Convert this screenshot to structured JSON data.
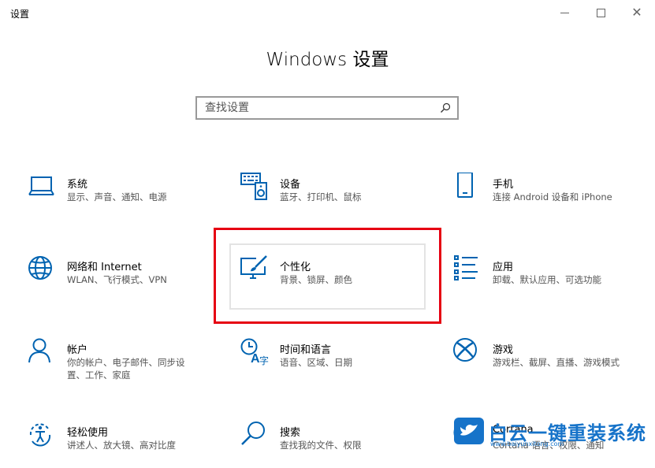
{
  "window": {
    "title": "设置",
    "heading": "Windows 设置"
  },
  "search": {
    "placeholder": "查找设置"
  },
  "accent_color": "#0063b1",
  "highlight_color": "#e60012",
  "tiles": [
    {
      "name": "系统",
      "desc": "显示、声音、通知、电源",
      "icon": "laptop-icon"
    },
    {
      "name": "设备",
      "desc": "蓝牙、打印机、鼠标",
      "icon": "keyboard-speaker-icon"
    },
    {
      "name": "手机",
      "desc": "连接 Android 设备和 iPhone",
      "icon": "phone-icon"
    },
    {
      "name": "网络和 Internet",
      "desc": "WLAN、飞行模式、VPN",
      "icon": "globe-icon"
    },
    {
      "name": "个性化",
      "desc": "背景、锁屏、颜色",
      "icon": "monitor-brush-icon"
    },
    {
      "name": "应用",
      "desc": "卸载、默认应用、可选功能",
      "icon": "app-list-icon"
    },
    {
      "name": "帐户",
      "desc": "你的帐户、电子邮件、同步设置、工作、家庭",
      "icon": "person-icon"
    },
    {
      "name": "时间和语言",
      "desc": "语音、区域、日期",
      "icon": "clock-language-icon"
    },
    {
      "name": "游戏",
      "desc": "游戏栏、截屏、直播、游戏模式",
      "icon": "xbox-icon"
    },
    {
      "name": "轻松使用",
      "desc": "讲述人、放大镜、高对比度",
      "icon": "ease-of-access-icon"
    },
    {
      "name": "搜索",
      "desc": "查找我的文件、权限",
      "icon": "search-icon"
    },
    {
      "name": "Cortana",
      "desc": "Cortana 语言、权限、通知",
      "icon": "cortana-icon"
    }
  ],
  "watermark": {
    "text": "白云一键重装系统",
    "url": "www.baiyunxitong.com"
  }
}
